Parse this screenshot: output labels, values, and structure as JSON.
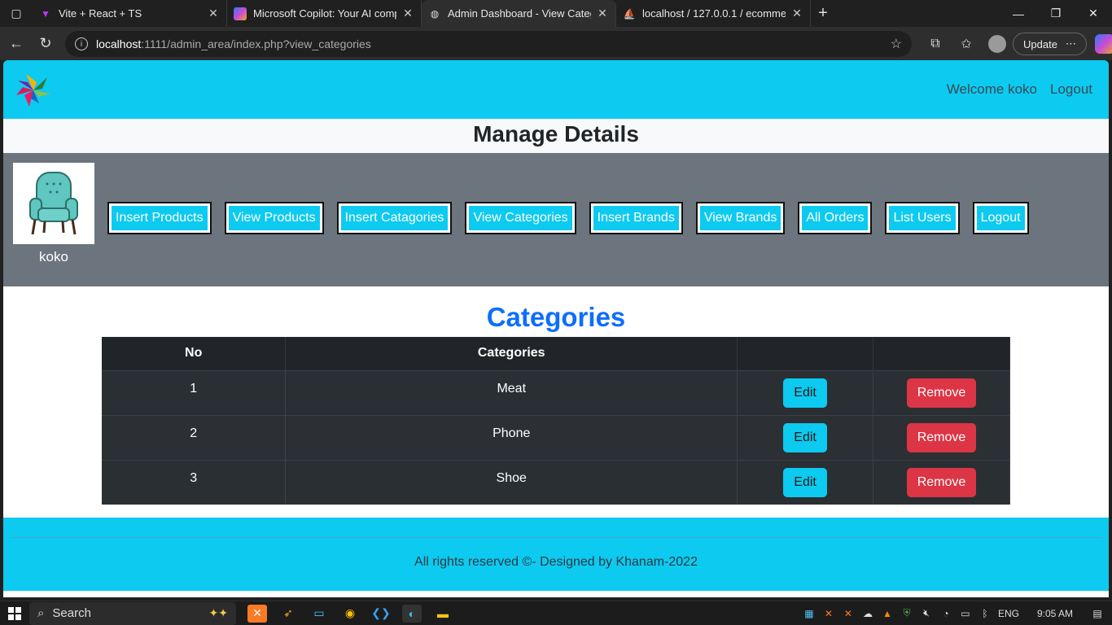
{
  "browser": {
    "tabs": [
      {
        "title": "Vite + React + TS",
        "active": false,
        "icon": "vite-icon"
      },
      {
        "title": "Microsoft Copilot: Your AI compa",
        "active": false,
        "icon": "copilot-icon"
      },
      {
        "title": "Admin Dashboard - View Catego",
        "active": true,
        "icon": "globe-icon"
      },
      {
        "title": "localhost / 127.0.0.1 / ecommerc",
        "active": false,
        "icon": "phpmyadmin-icon"
      }
    ],
    "url_host": "localhost",
    "url_path": ":1111/admin_area/index.php?view_categories",
    "update_label": "Update"
  },
  "header": {
    "welcome": "Welcome koko",
    "logout": "Logout"
  },
  "manage_title": "Manage Details",
  "admin": {
    "name": "koko",
    "menu": [
      "Insert Products",
      "View Products",
      "Insert Catagories",
      "View Categories",
      "Insert Brands",
      "View Brands",
      "All Orders",
      "List Users",
      "Logout"
    ]
  },
  "categories": {
    "title": "Categories",
    "columns": [
      "No",
      "Categories",
      "",
      ""
    ],
    "rows": [
      {
        "no": "1",
        "name": "Meat",
        "edit": "Edit",
        "remove": "Remove"
      },
      {
        "no": "2",
        "name": "Phone",
        "edit": "Edit",
        "remove": "Remove"
      },
      {
        "no": "3",
        "name": "Shoe",
        "edit": "Edit",
        "remove": "Remove"
      }
    ]
  },
  "footer": {
    "text": "All rights reserved ©- Designed by Khanam-2022"
  },
  "taskbar": {
    "search": "Search",
    "language": "ENG",
    "time": "9:05 AM"
  },
  "colors": {
    "accent": "#0dcaf0",
    "primary": "#0d6efd",
    "danger": "#dc3545",
    "band": "#6c757d",
    "table": "#212529"
  }
}
